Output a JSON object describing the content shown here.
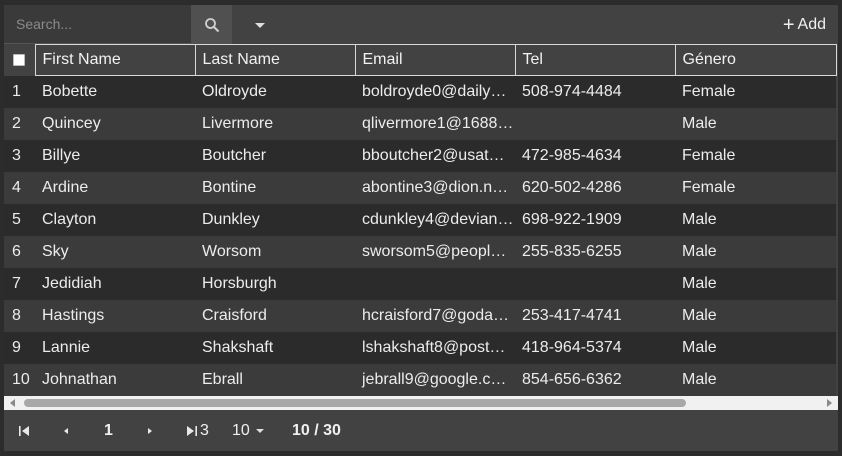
{
  "search": {
    "placeholder": "Search..."
  },
  "toolbar": {
    "add_label": "Add"
  },
  "table": {
    "columns": [
      "First Name",
      "Last Name",
      "Email",
      "Tel",
      "Género"
    ],
    "rows": [
      {
        "n": "1",
        "first": "Bobette",
        "last": "Oldroyde",
        "email": "boldroyde0@daily…",
        "tel": "508-974-4484",
        "gender": "Female"
      },
      {
        "n": "2",
        "first": "Quincey",
        "last": "Livermore",
        "email": "qlivermore1@1688…",
        "tel": "",
        "gender": "Male"
      },
      {
        "n": "3",
        "first": "Billye",
        "last": "Boutcher",
        "email": "bboutcher2@usat…",
        "tel": "472-985-4634",
        "gender": "Female"
      },
      {
        "n": "4",
        "first": "Ardine",
        "last": "Bontine",
        "email": "abontine3@dion.n…",
        "tel": "620-502-4286",
        "gender": "Female"
      },
      {
        "n": "5",
        "first": "Clayton",
        "last": "Dunkley",
        "email": "cdunkley4@devian…",
        "tel": "698-922-1909",
        "gender": "Male"
      },
      {
        "n": "6",
        "first": "Sky",
        "last": "Worsom",
        "email": "sworsom5@peopl…",
        "tel": "255-835-6255",
        "gender": "Male"
      },
      {
        "n": "7",
        "first": "Jedidiah",
        "last": "Horsburgh",
        "email": "",
        "tel": "",
        "gender": "Male"
      },
      {
        "n": "8",
        "first": "Hastings",
        "last": "Craisford",
        "email": "hcraisford7@goda…",
        "tel": "253-417-4741",
        "gender": "Male"
      },
      {
        "n": "9",
        "first": "Lannie",
        "last": "Shakshaft",
        "email": "lshakshaft8@post…",
        "tel": "418-964-5374",
        "gender": "Male"
      },
      {
        "n": "10",
        "first": "Johnathan",
        "last": "Ebrall",
        "email": "jebrall9@google.c…",
        "tel": "854-656-6362",
        "gender": "Male"
      }
    ]
  },
  "pager": {
    "current_page": "1",
    "total_pages": "3",
    "page_size": "10",
    "count": "10 / 30"
  },
  "icons": {
    "search": "search-icon",
    "dropdown": "chevron-down-icon",
    "add": "plus-icon",
    "first": "first-page-icon",
    "prev": "prev-page-icon",
    "next": "next-page-icon",
    "last": "last-page-icon"
  }
}
